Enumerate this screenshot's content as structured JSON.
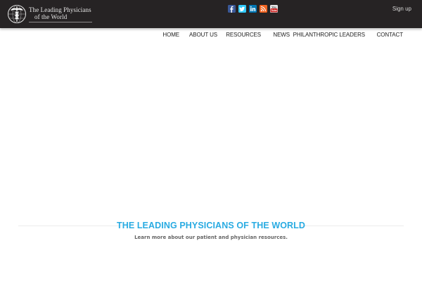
{
  "header": {
    "logo_alt": "The Leading Physicians of the World",
    "logo_line1": "The Leading Physicians",
    "logo_line2": "of the World",
    "signup_label": "Sign up",
    "social": [
      {
        "name": "facebook",
        "icon": "facebook-icon",
        "color": "#3b5998"
      },
      {
        "name": "twitter",
        "icon": "twitter-icon",
        "color": "#1da1f2"
      },
      {
        "name": "linkedin",
        "icon": "linkedin-icon",
        "color": "#0077b5"
      },
      {
        "name": "rss",
        "icon": "rss-icon",
        "color": "#f26522"
      },
      {
        "name": "youtube",
        "icon": "youtube-icon",
        "color": "#cd201f"
      }
    ]
  },
  "nav": {
    "items": [
      {
        "label": "HOME"
      },
      {
        "label": "ABOUT US"
      },
      {
        "label": "RESOURCES"
      },
      {
        "label": "NEWS"
      },
      {
        "label": "PHILANTHROPIC LEADERS"
      },
      {
        "label": "CONTACT"
      }
    ]
  },
  "hero": {
    "title": "THE LEADING PHYSICIANS OF THE WORLD",
    "subtitle": "Learn more about our patient and physician resources."
  },
  "colors": {
    "topbar": "#262324",
    "accent": "#29abe2",
    "nav_text": "#222222",
    "subtitle_text": "#666666"
  }
}
